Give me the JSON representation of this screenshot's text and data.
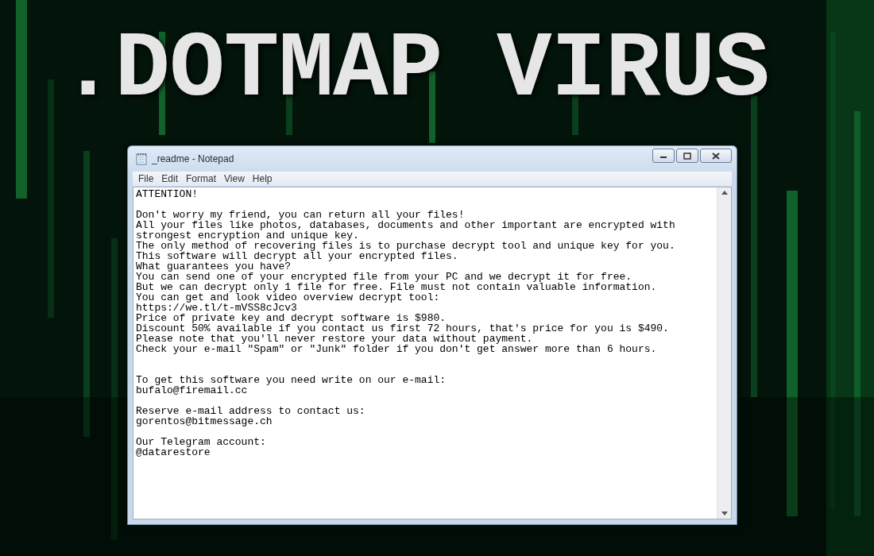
{
  "headline": ".DOTMAP VIRUS",
  "window": {
    "title": "_readme - Notepad"
  },
  "menu": [
    "File",
    "Edit",
    "Format",
    "View",
    "Help"
  ],
  "document": {
    "sections": [
      {
        "paragraphs": [
          [
            "ATTENTION!"
          ],
          [
            "Don't worry my friend, you can return all your files!",
            "All your files like photos, databases, documents and other important are encrypted with",
            "strongest encryption and unique key.",
            "The only method of recovering files is to purchase decrypt tool and unique key for you.",
            "This software will decrypt all your encrypted files.",
            "What guarantees you have?",
            "You can send one of your encrypted file from your PC and we decrypt it for free.",
            "But we can decrypt only 1 file for free. File must not contain valuable information.",
            "You can get and look video overview decrypt tool:",
            "https://we.tl/t-mVSS8cJcv3",
            "Price of private key and decrypt software is $980.",
            "Discount 50% available if you contact us first 72 hours, that's price for you is $490.",
            "Please note that you'll never restore your data without payment.",
            "Check your e-mail \"Spam\" or \"Junk\" folder if you don't get answer more than 6 hours."
          ]
        ]
      },
      {
        "paragraphs": [
          [
            "To get this software you need write on our e-mail:",
            "bufalo@firemail.cc"
          ],
          [
            "Reserve e-mail address to contact us:",
            "gorentos@bitmessage.ch"
          ],
          [
            "Our Telegram account:",
            "@datarestore"
          ]
        ]
      }
    ]
  }
}
